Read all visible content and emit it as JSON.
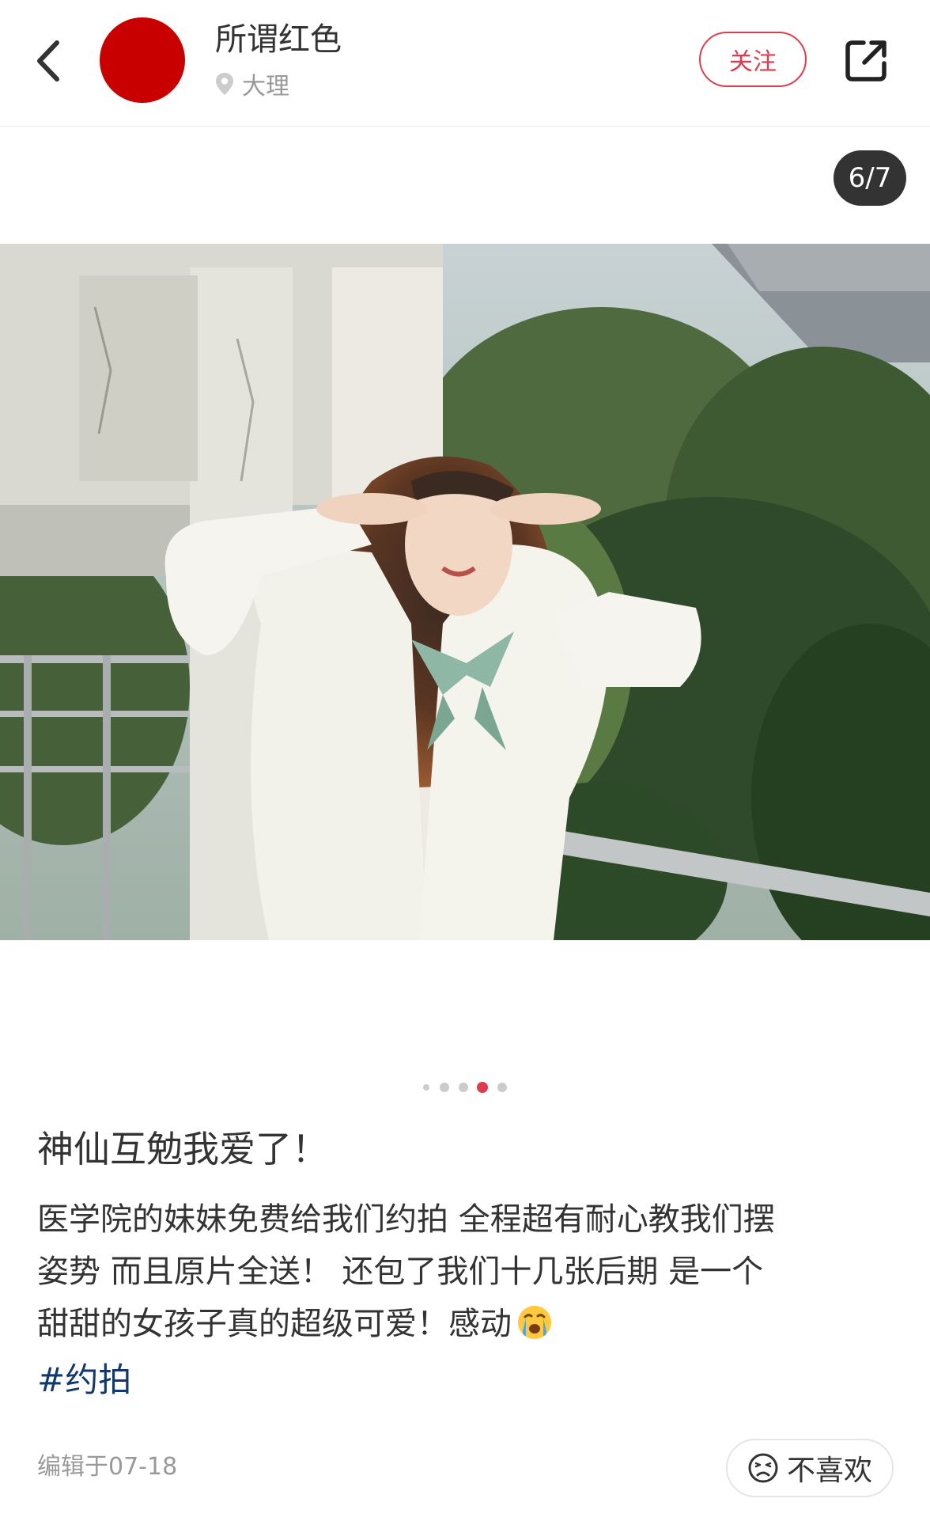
{
  "header": {
    "author_name": "所谓红色",
    "location": "大理",
    "follow_label": "关注",
    "avatar_color": "#c90000",
    "icons": {
      "back": "back-chevron-icon",
      "location": "location-pin-icon",
      "share": "share-icon"
    }
  },
  "gallery": {
    "counter": "6/7",
    "dots": {
      "count": 5,
      "active_index": 3,
      "active_color": "#e03a4f"
    },
    "photo_description_icon": "photo"
  },
  "post": {
    "title": "神仙互勉我爱了！",
    "body_lines": [
      "医学院的妹妹免费给我们约拍 全程超有耐心教我们摆",
      "姿势 而且原片全送！ 还包了我们十几张后期 是一个",
      "甜甜的女孩子真的超级可爱！感动"
    ],
    "body_emoji": "crying-face-icon",
    "hashtag": "#约拍"
  },
  "footer": {
    "edit_date": "编辑于07-18",
    "dislike_label": "不喜欢",
    "dislike_icon": "unhappy-face-icon"
  },
  "colors": {
    "accent": "#e03a4f",
    "hashtag": "#13386c",
    "secondary_text": "#999999"
  }
}
